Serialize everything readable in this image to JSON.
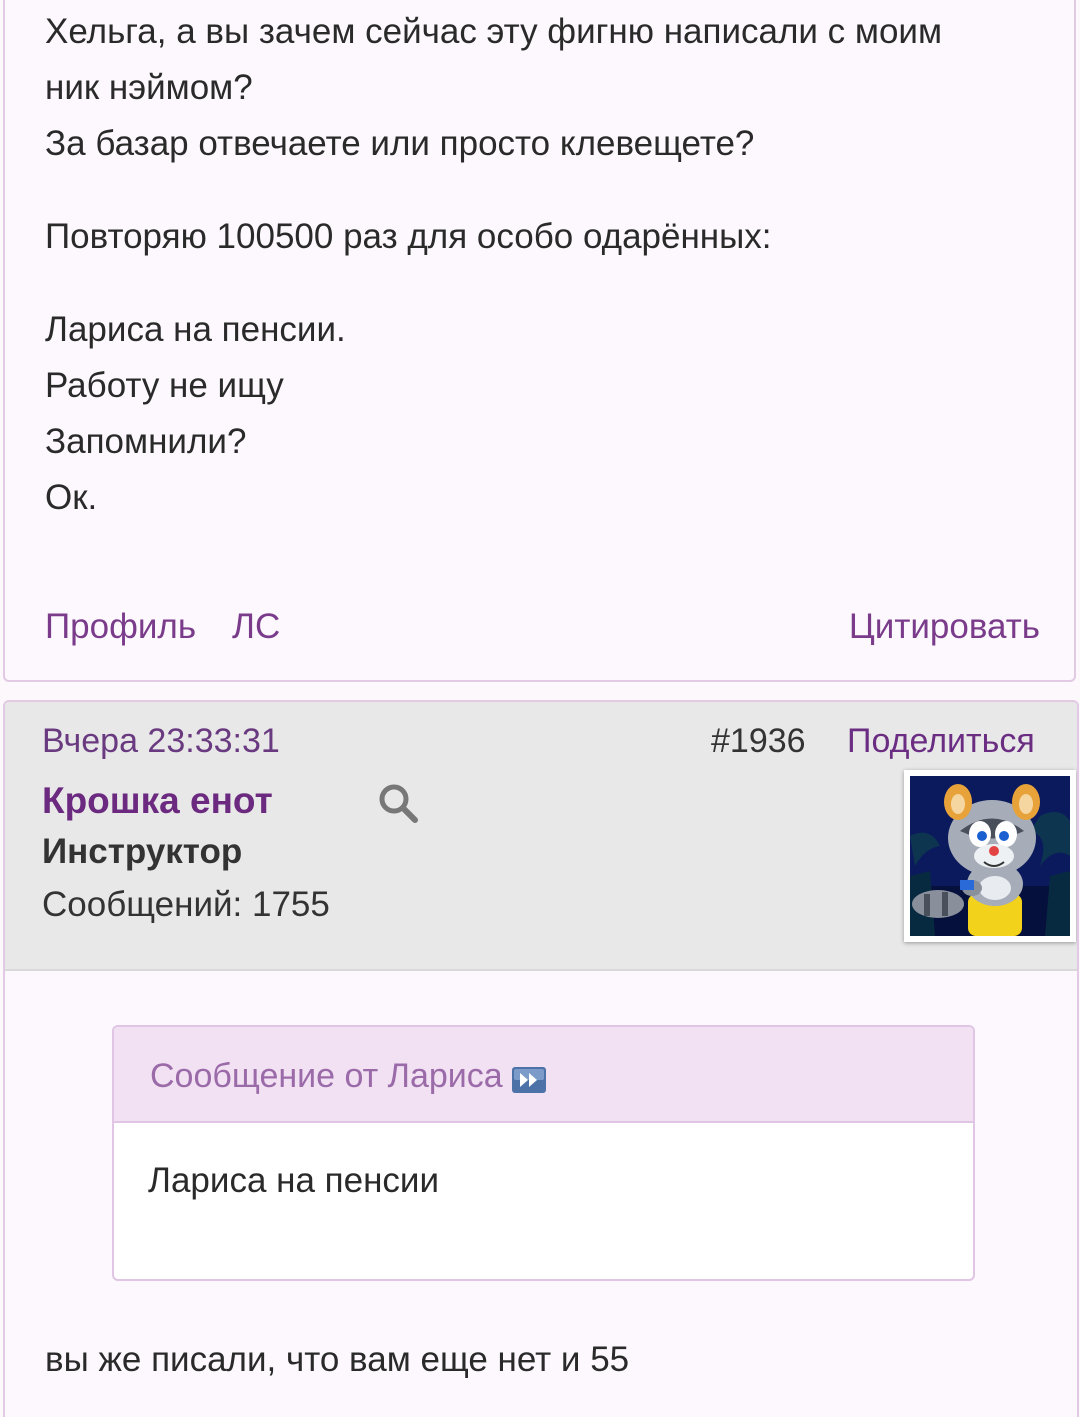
{
  "post_prev": {
    "lines": [
      "Хельга, а вы зачем сейчас эту фигню написали с моим",
      "ник нэймом?",
      "За базар отвечаете или просто клевещете?",
      "Повторяю 100500 раз для особо одарённых:",
      "Лариса на пенсии.",
      "Работу не ищу",
      "Запомнили?",
      "Ок."
    ],
    "links": {
      "profile": "Профиль",
      "pm": "ЛС",
      "quote": "Цитировать"
    }
  },
  "post": {
    "date": "Вчера 23:33:31",
    "number": "#1936",
    "share": "Поделиться",
    "author": {
      "name": "Крошка енот",
      "rank": "Инструктор",
      "messages": "Сообщений: 1755",
      "search_icon": "search-icon",
      "avatar": "raccoon-cartoon-avatar"
    },
    "quote": {
      "title": "Сообщение от Лариса",
      "jump_icon": "jump-to-post-icon",
      "body": "Лариса на пенсии"
    },
    "text": "вы же писали, что вам еще нет и 55"
  },
  "colors": {
    "accent": "#6b2a80",
    "border": "#e2c9e4",
    "header_bg": "#e8e8e8",
    "quote_head_bg": "#f1e1f3"
  }
}
